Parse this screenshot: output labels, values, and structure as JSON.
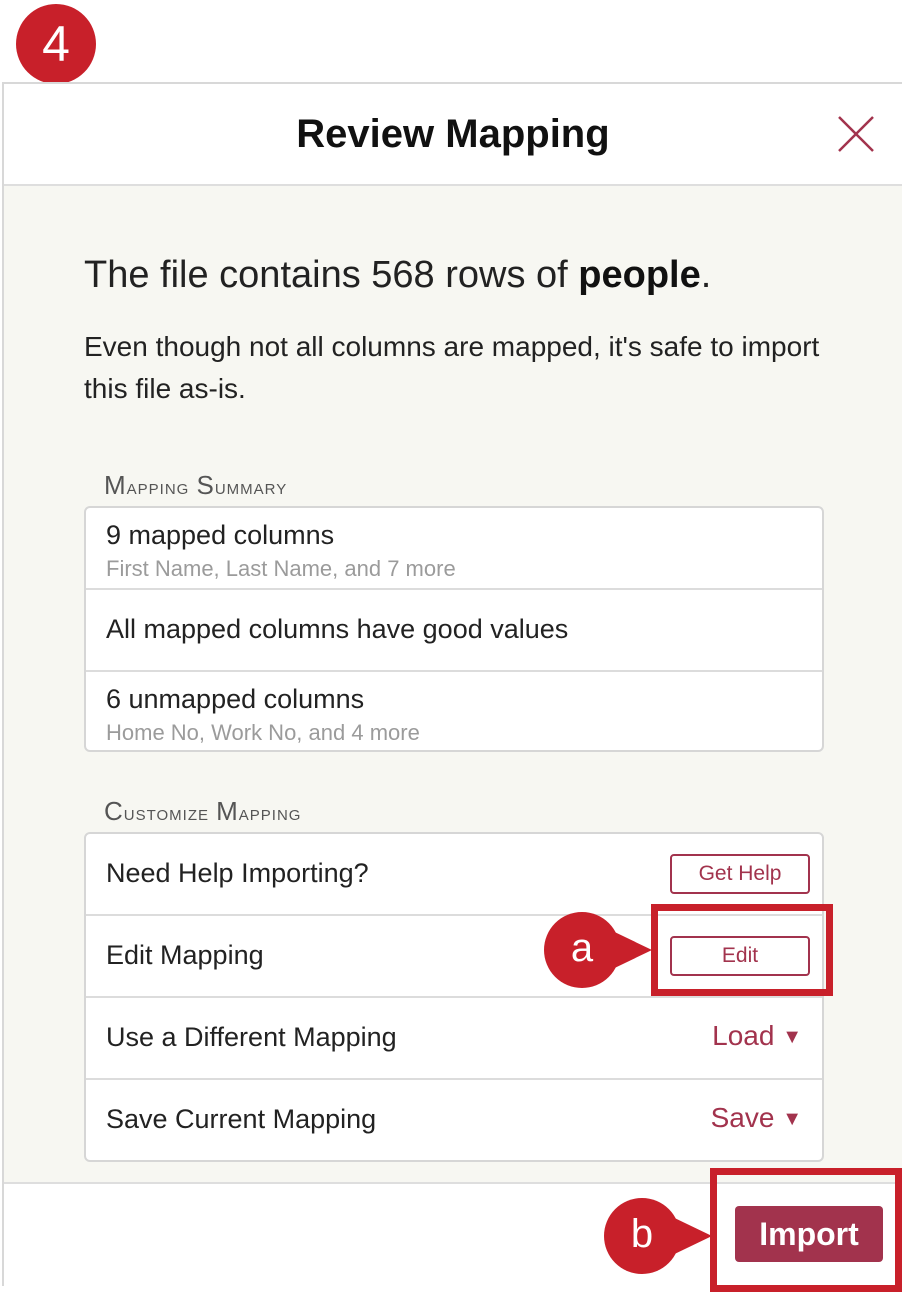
{
  "step_number": "4",
  "dialog": {
    "title": "Review Mapping",
    "headline_prefix": "The file contains 568 rows of ",
    "headline_bold": "people",
    "headline_suffix": ".",
    "note": "Even though not all columns are mapped, it's safe to import this file as-is."
  },
  "mapping_summary": {
    "label_first": "M",
    "label_rest": "apping ",
    "label_second": "S",
    "label_second_rest": "ummary",
    "rows": [
      {
        "title": "9 mapped columns",
        "subtitle": "First Name, Last Name, and 7 more"
      },
      {
        "title": "All mapped columns have good values"
      },
      {
        "title": "6 unmapped columns",
        "subtitle": "Home No, Work No, and 4 more"
      }
    ]
  },
  "customize_mapping": {
    "label_first": "C",
    "label_rest": "ustomize ",
    "label_second": "M",
    "label_second_rest": "apping",
    "rows": [
      {
        "title": "Need Help Importing?",
        "action": "Get Help"
      },
      {
        "title": "Edit Mapping",
        "action": "Edit"
      },
      {
        "title": "Use a Different Mapping",
        "action": "Load"
      },
      {
        "title": "Save Current Mapping",
        "action": "Save"
      }
    ]
  },
  "footer": {
    "import_label": "Import"
  },
  "callouts": {
    "a": "a",
    "b": "b"
  },
  "colors": {
    "accent": "#a2334d",
    "annotation_red": "#c8202a"
  }
}
